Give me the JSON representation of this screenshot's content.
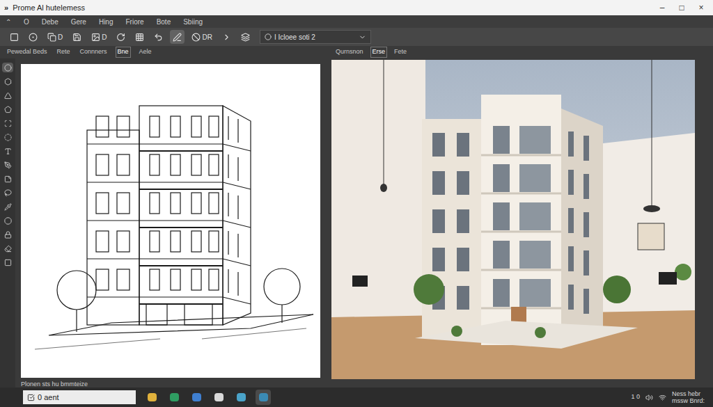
{
  "window": {
    "logo": "»",
    "title": "Prome Al hutelemess",
    "controls": [
      "–",
      "□",
      "×"
    ]
  },
  "menu": [
    "⌃",
    "O",
    "Debe",
    "Gere",
    "Hing",
    "Friore",
    "Bote",
    "Sbiing"
  ],
  "toolbar": {
    "tools": [
      {
        "text": "",
        "selected": false
      },
      {
        "text": "",
        "selected": false
      },
      {
        "text": "D",
        "selected": false
      },
      {
        "text": "",
        "selected": false
      },
      {
        "text": "D",
        "selected": false
      },
      {
        "text": "",
        "selected": false
      },
      {
        "text": "",
        "selected": false
      },
      {
        "text": "",
        "selected": false
      },
      {
        "text": "",
        "selected": true
      },
      {
        "text": "DR",
        "selected": false
      },
      {
        "text": "",
        "selected": false
      },
      {
        "text": "",
        "selected": false
      }
    ],
    "dropdown": {
      "value": "I Icloee soti 2"
    }
  },
  "left_tabs": [
    {
      "label": "Pewedal Beds",
      "selected": false
    },
    {
      "label": "Rete",
      "selected": false
    },
    {
      "label": "Connners",
      "selected": false
    },
    {
      "label": "Bne",
      "selected": true
    },
    {
      "label": "Aele",
      "selected": false
    }
  ],
  "right_tabs": [
    {
      "label": "Qurnsnon",
      "selected": false
    },
    {
      "label": "Erse",
      "selected": true
    },
    {
      "label": "Fete",
      "selected": false
    }
  ],
  "sidebar_tools": [
    {
      "selected": true
    },
    {
      "selected": false
    },
    {
      "selected": false
    },
    {
      "selected": false
    },
    {
      "selected": false
    },
    {
      "selected": false
    },
    {
      "selected": false
    },
    {
      "selected": false
    },
    {
      "selected": false
    },
    {
      "selected": false
    },
    {
      "selected": false
    },
    {
      "selected": false
    },
    {
      "selected": false
    },
    {
      "selected": false
    },
    {
      "selected": false
    }
  ],
  "status_bar": "Plonen sts hu bmmteize",
  "taskbar": {
    "search": "0 aent",
    "apps": [
      {
        "selected": false
      },
      {
        "selected": false
      },
      {
        "selected": false
      },
      {
        "selected": false
      },
      {
        "selected": false
      },
      {
        "selected": true
      }
    ],
    "tray": [
      "1 0",
      "Ness hebr",
      "mssw Bnrd:"
    ]
  }
}
